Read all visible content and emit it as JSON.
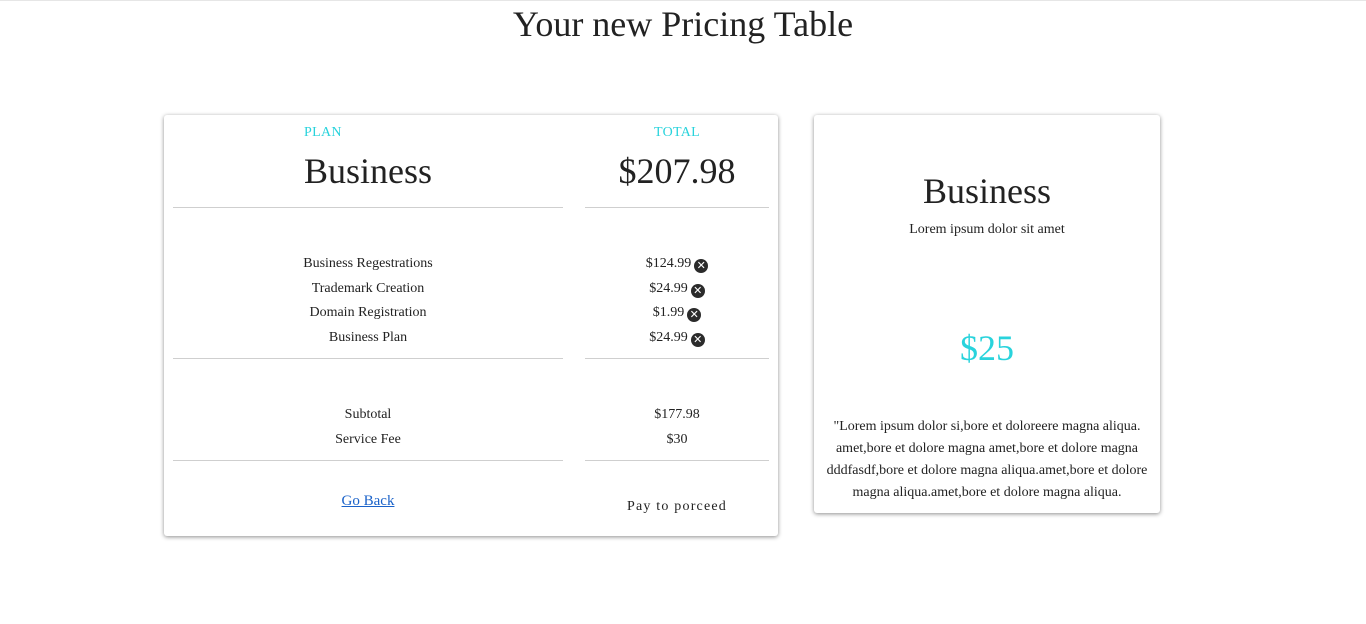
{
  "page": {
    "title": "Your new Pricing Table"
  },
  "checkout": {
    "plan_label": "PLAN",
    "plan_name": "Business",
    "total_label": "TOTAL",
    "total_value": "$207.98",
    "items": [
      {
        "name": "Business Regestrations",
        "price": "$124.99"
      },
      {
        "name": "Trademark Creation",
        "price": "$24.99"
      },
      {
        "name": "Domain Registration",
        "price": "$1.99"
      },
      {
        "name": "Business Plan",
        "price": "$24.99"
      }
    ],
    "totals": [
      {
        "name": "Subtotal",
        "value": "$177.98"
      },
      {
        "name": "Service Fee",
        "value": "$30"
      }
    ],
    "back_label": "Go Back",
    "pay_label": "Pay to porceed",
    "remove_icon": "close-circle-icon"
  },
  "plan_card": {
    "title": "Business",
    "subtitle": "Lorem ipsum dolor sit amet",
    "price": "$25",
    "description": "\"Lorem ipsum dolor si,bore et doloreere magna aliqua. amet,bore et dolore magna amet,bore et dolore magna dddfasdf,bore et dolore magna aliqua.amet,bore et dolore magna aliqua.amet,bore et dolore magna aliqua."
  },
  "colors": {
    "accent": "#29d3dc",
    "link": "#1a62c9",
    "text": "#222222",
    "divider": "#cfcfcf"
  }
}
